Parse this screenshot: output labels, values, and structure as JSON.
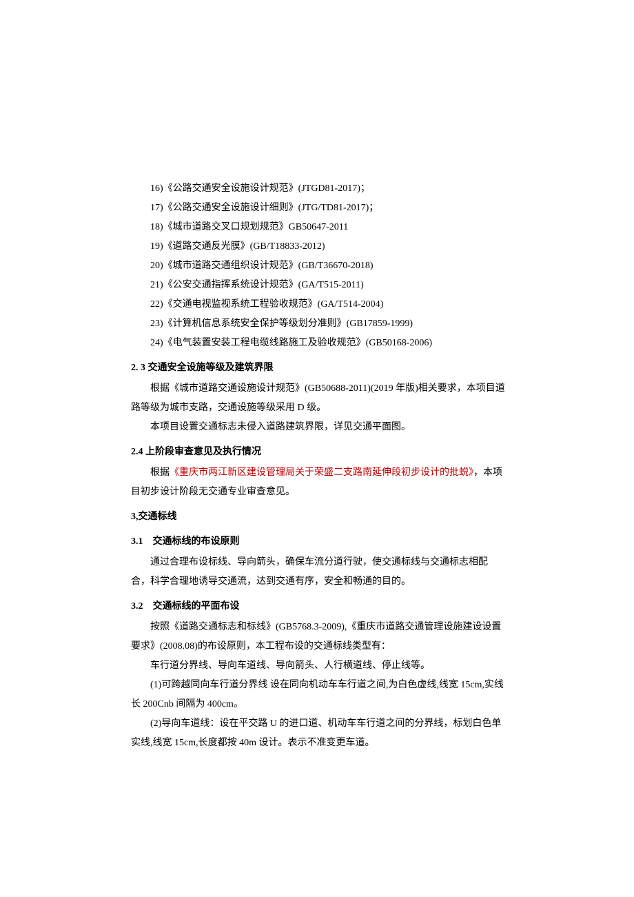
{
  "standards": {
    "s16": "16)《公路交通安全设施设计规范》(JTGD81-2017)；",
    "s17": "17)《公路交通安全设施设计细则》(JTG/TD81-2017)；",
    "s18": "18)《城市道路交叉口规划规范》GB50647-2011",
    "s19": "19)《道路交通反光膜》(GB/T18833-2012)",
    "s20": "20)《城市道路交通组织设计规范》(GB/T36670-2018)",
    "s21": "21)《公安交通指挥系统设计规范》(GA/T515-2011)",
    "s22": "22)《交通电视监视系统工程验收规范》(GA/T514-2004)",
    "s23": "23)《计算机信息系统安全保护等级划分准则》(GB17859-1999)",
    "s24": "24)《电气装置安装工程电缆线路施工及验收规范》(GB50168-2006)"
  },
  "sec2_3": {
    "heading": "2.   3 交通安全设施等级及建筑界限",
    "p1": "根据《城市道路交通设施设计规范》(GB50688-2011)(2019 年版)相关要求，本项目道路等级为城市支路，交通设施等级采用 D 级。",
    "p2": "本项目设置交通标志未侵入道路建筑界限，详见交通平面图。"
  },
  "sec2_4": {
    "heading": "2.4 上阶段审查意见及执行情况",
    "p1_a": "根据",
    "p1_red": "《重庆市两江新区建设管理局关于荣盛二支路南延伸段初步设计的批蜕》",
    "p1_b": "，本项目初步设计阶段无交通专业审查意见。"
  },
  "sec3": {
    "heading": "3,交通标线"
  },
  "sec3_1": {
    "heading": "3.1 交通标线的布设原则",
    "p1": "通过合理布设标线、导向箭头，确保车流分道行驶，使交通标线与交通标志相配合，科学合理地诱导交通流，达到交通有序，安全和畅通的目的。"
  },
  "sec3_2": {
    "heading": "3.2 交通标线的平面布设",
    "p1": "按照《道路交通标志和标线》(GB5768.3-2009),《重庆市道路交通管理设施建设设置要求》(2008.08)的布设原则，本工程布设的交通标线类型有：",
    "p2": "车行道分界线、导向车道线、导向箭头、人行横道线、停止线等。",
    "p3": "(1)可跨越同向车行道分界线 设在同向机动车车行道之间,为白色虚线,线宽 15cm,实线长 200Cnb 间隔为 400cm。",
    "p4": "(2)导向车道线：设在平交路 U 的进口道、机动车车行道之间的分界线，标划白色单实线,线宽 15cm,长度都按 40m 设计。表示不准变更车道。"
  }
}
